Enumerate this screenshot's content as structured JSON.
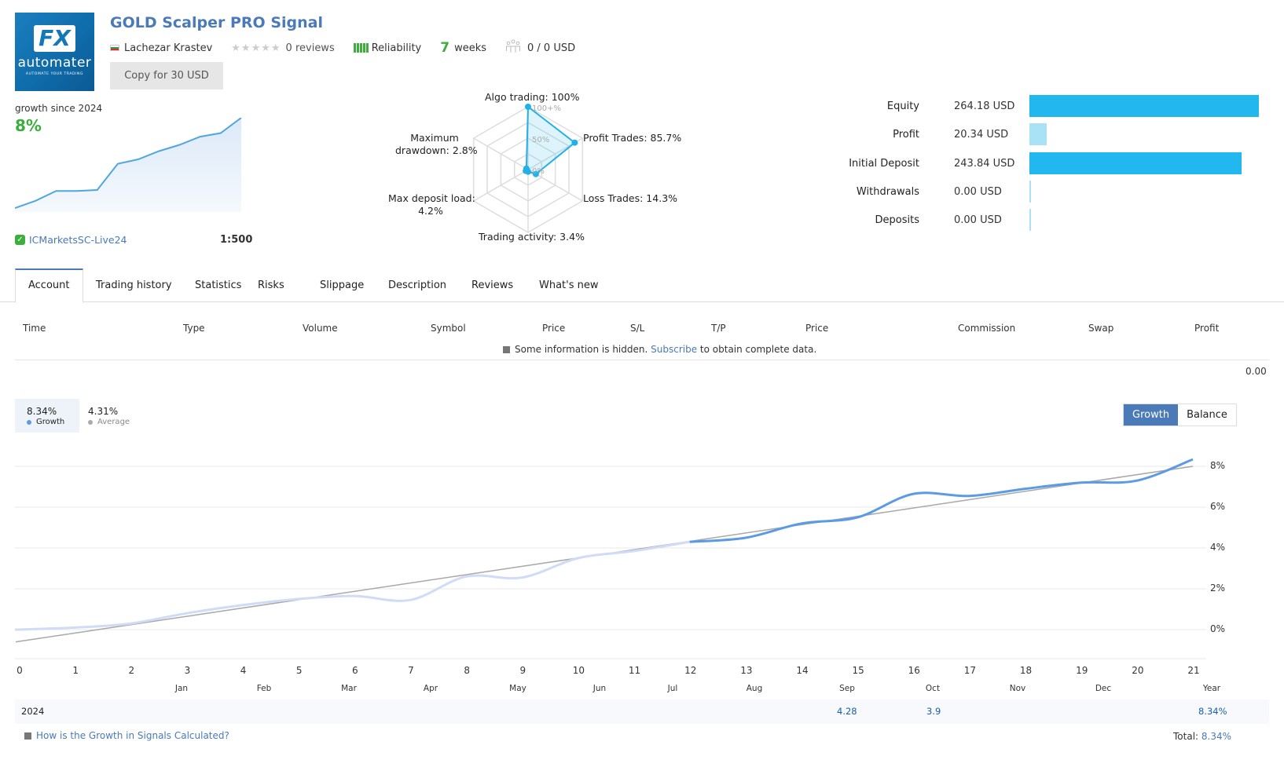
{
  "header": {
    "logo_text": "FX",
    "logo_brand": "automater",
    "logo_tagline": "AUTOMATE YOUR TRADING",
    "title": "GOLD Scalper PRO Signal",
    "author": "Lachezar Krastev",
    "rating_stars": 0,
    "reviews": "0 reviews",
    "reliability_label": "Reliability",
    "reliability_bars": 5,
    "weeks_num": "7",
    "weeks_label": "weeks",
    "subscribers": "0 / 0 USD",
    "copy_button": "Copy for 30 USD"
  },
  "colors": {
    "accent": "#4a7ab8",
    "green": "#3cae3c",
    "bar_blue": "#22b7ef",
    "bar_light": "#a9e1f7",
    "growth_line": "#5b9be6",
    "growth_faded": "#d0dcf5",
    "average_line": "#a8a8a8"
  },
  "growth_summary": {
    "label": "growth since 2024",
    "value": "8%",
    "broker": "ICMarketsSC-Live24",
    "leverage": "1:500",
    "sparkline": [
      0,
      0.8,
      1.9,
      1.9,
      2.0,
      4.9,
      5.4,
      6.3,
      7.0,
      7.9,
      8.3,
      10.0
    ]
  },
  "radar": {
    "axes": [
      {
        "label": "Algo trading: 100%",
        "value": 100
      },
      {
        "label": "Profit Trades: 85.7%",
        "value": 85.7
      },
      {
        "label": "Loss Trades: 14.3%",
        "value": 14.3
      },
      {
        "label": "Trading activity: 3.4%",
        "value": 3.4
      },
      {
        "label": "Max deposit load: 4.2%",
        "value": 4.2
      },
      {
        "label": "Maximum drawdown: 2.8%",
        "value": 2.8
      }
    ],
    "label_lines": {
      "algo": "Algo trading: 100%",
      "profit": "Profit Trades: 85.7%",
      "loss": "Loss Trades: 14.3%",
      "activity": "Trading activity: 3.4%",
      "load_1": "Max deposit load:",
      "load_2": "4.2%",
      "dd_1": "Maximum",
      "dd_2": "drawdown: 2.8%"
    },
    "scale_labels": [
      "100+%",
      "50%",
      "0%"
    ]
  },
  "balances": [
    {
      "name": "Equity",
      "value": "264.18 USD",
      "amount": 264.18,
      "style": "dark"
    },
    {
      "name": "Profit",
      "value": "20.34 USD",
      "amount": 20.34,
      "style": "light"
    },
    {
      "name": "Initial Deposit",
      "value": "243.84 USD",
      "amount": 243.84,
      "style": "dark"
    },
    {
      "name": "Withdrawals",
      "value": "0.00 USD",
      "amount": 0,
      "style": "light"
    },
    {
      "name": "Deposits",
      "value": "0.00 USD",
      "amount": 0,
      "style": "light"
    }
  ],
  "tabs": [
    "Account",
    "Trading history",
    "Statistics",
    "Risks",
    "Slippage",
    "Description",
    "Reviews",
    "What's new"
  ],
  "active_tab": "Account",
  "table": {
    "columns": [
      "Time",
      "Type",
      "Volume",
      "Symbol",
      "Price",
      "S/L",
      "T/P",
      "Price",
      "Commission",
      "Swap",
      "Profit"
    ],
    "hidden_msg_pre": "Some information is hidden.",
    "hidden_msg_link": "Subscribe",
    "hidden_msg_post": "to obtain complete data.",
    "total_profit": "0.00"
  },
  "growth_chart": {
    "legend": [
      {
        "value": "8.34%",
        "label": "Growth"
      },
      {
        "value": "4.31%",
        "label": "Average"
      }
    ],
    "toggle": [
      "Growth",
      "Balance"
    ],
    "toggle_active": "Growth",
    "year_row": {
      "year": "2024",
      "sep": "4.28",
      "oct": "3.9",
      "year_total": "8.34%"
    },
    "months": [
      "Jan",
      "Feb",
      "Mar",
      "Apr",
      "May",
      "Jun",
      "Jul",
      "Aug",
      "Sep",
      "Oct",
      "Nov",
      "Dec",
      "Year"
    ],
    "how_link": "How is the Growth in Signals Calculated?",
    "total_label": "Total:",
    "total_value": "8.34%"
  },
  "chart_data": {
    "type": "line",
    "title": "Growth",
    "xlabel": "",
    "ylabel": "",
    "x": [
      0,
      1,
      2,
      3,
      4,
      5,
      6,
      7,
      8,
      9,
      10,
      11,
      12,
      13,
      14,
      15,
      16,
      17,
      18,
      19,
      20,
      21
    ],
    "xlim": [
      0,
      21
    ],
    "ylim": [
      -1.5,
      9
    ],
    "y_ticks": [
      0,
      2,
      4,
      6,
      8
    ],
    "y_tick_labels": [
      "0%",
      "2%",
      "4%",
      "6%",
      "8%"
    ],
    "x_tick_labels": [
      "0",
      "1",
      "2",
      "3",
      "4",
      "5",
      "6",
      "7",
      "8",
      "9",
      "10",
      "11",
      "12",
      "13",
      "14",
      "15",
      "16",
      "17",
      "18",
      "19",
      "20",
      "21"
    ],
    "grid": true,
    "legend": "top-left",
    "series": [
      {
        "name": "Growth",
        "values": [
          0,
          0.1,
          0.3,
          0.8,
          1.2,
          1.5,
          1.65,
          1.45,
          2.6,
          2.55,
          3.5,
          3.85,
          4.3,
          4.5,
          5.2,
          5.5,
          6.65,
          6.55,
          6.9,
          7.2,
          7.3,
          8.34
        ],
        "highlight_from": 12
      },
      {
        "name": "Average",
        "values": [
          -0.6,
          -0.2,
          0.2,
          0.6,
          1.0,
          1.4,
          1.8,
          2.2,
          2.6,
          3.0,
          3.4,
          3.8,
          4.2,
          4.6,
          5.0,
          5.4,
          5.8,
          6.2,
          6.6,
          7.0,
          7.4,
          8.0
        ]
      }
    ]
  }
}
